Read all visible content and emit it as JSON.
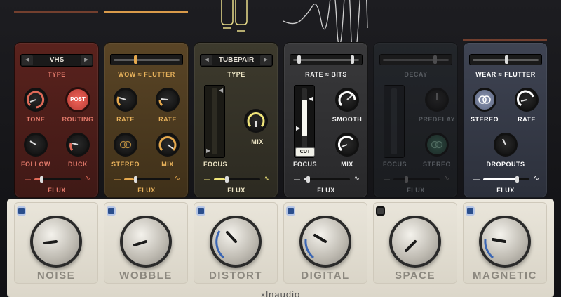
{
  "brand": "xlnaudio",
  "modules": {
    "noise": {
      "type_value": "VHS",
      "type_label": "TYPE",
      "knob1_label": "TONE",
      "routing_label": "ROUTING",
      "routing_button": "POST",
      "knob3_label": "FOLLOW",
      "knob4_label": "DUCK",
      "flux_label": "FLUX"
    },
    "wobble": {
      "title_label": "WOW ≈ FLUTTER",
      "knob1_label": "RATE",
      "knob2_label": "RATE",
      "stereo_label": "STEREO",
      "mix_label": "MIX",
      "flux_label": "FLUX"
    },
    "distort": {
      "type_value": "TUBEPAIR",
      "type_label": "TYPE",
      "focus_label": "FOCUS",
      "mix_label": "MIX",
      "flux_label": "FLUX"
    },
    "digital": {
      "title_label": "RATE ≈ BITS",
      "cut_label": "CUT",
      "focus_label": "FOCUS",
      "smooth_label": "SMOOTH",
      "mix_label": "MIX",
      "flux_label": "FLUX"
    },
    "space": {
      "title_label": "DECAY",
      "predelay_label": "PREDELAY",
      "focus_label": "FOCUS",
      "stereo_label": "STEREO",
      "flux_label": "FLUX"
    },
    "magnetic": {
      "title_label": "WEAR ≈ FLUTTER",
      "stereo_label": "STEREO",
      "rate_label": "RATE",
      "dropouts_label": "DROPOUTS",
      "flux_label": "FLUX"
    }
  },
  "bottom": [
    {
      "label": "NOISE",
      "enabled": true
    },
    {
      "label": "WOBBLE",
      "enabled": true
    },
    {
      "label": "DISTORT",
      "enabled": true
    },
    {
      "label": "DIGITAL",
      "enabled": true
    },
    {
      "label": "SPACE",
      "enabled": false
    },
    {
      "label": "MAGNETIC",
      "enabled": true
    }
  ],
  "colors": {
    "noise_accent": "#e06a58",
    "wobble_accent": "#e6a94d",
    "distort_accent": "#f0e57a",
    "digital_accent": "#ffffff",
    "toggle_on": "#2a4e8c"
  }
}
